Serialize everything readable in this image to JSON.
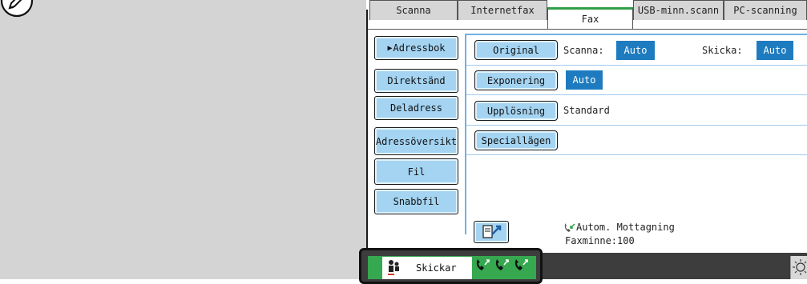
{
  "tabs": [
    {
      "label": "Scanna"
    },
    {
      "label": "Internetfax"
    },
    {
      "label": "Fax",
      "active": true
    },
    {
      "label": "USB-minn.scann"
    },
    {
      "label": "PC-scanning"
    }
  ],
  "sidebar": {
    "address_book": "Adressbok",
    "direct_send": "Direktsänd",
    "sub_address": "Deladress",
    "address_review": "Adressöversikt",
    "file": "Fil",
    "quick_file": "Snabbfil"
  },
  "settings": {
    "original": {
      "button": "Original",
      "scan_label": "Scanna:",
      "scan_value": "Auto",
      "send_label": "Skicka:",
      "send_value": "Auto"
    },
    "exposure": {
      "button": "Exponering",
      "value": "Auto"
    },
    "resolution": {
      "button": "Upplösning",
      "value": "Standard"
    },
    "special_modes": {
      "button": "Speciallägen"
    }
  },
  "status": {
    "reception": "Autom. Mottagning",
    "memory": "Faxminne:100"
  },
  "job_status": {
    "label": "Skickar"
  },
  "colors": {
    "button_fill": "#a4d4f2",
    "value_fill": "#1e7bbf",
    "active_tab_accent": "#2f9e47",
    "status_green": "#36a84f",
    "bottom_bar": "#3d3d3d"
  },
  "icons": [
    "pen-icon",
    "address-book-icon",
    "phone-receive-icon",
    "sender-icon",
    "fax-line-icon",
    "brightness-icon"
  ]
}
